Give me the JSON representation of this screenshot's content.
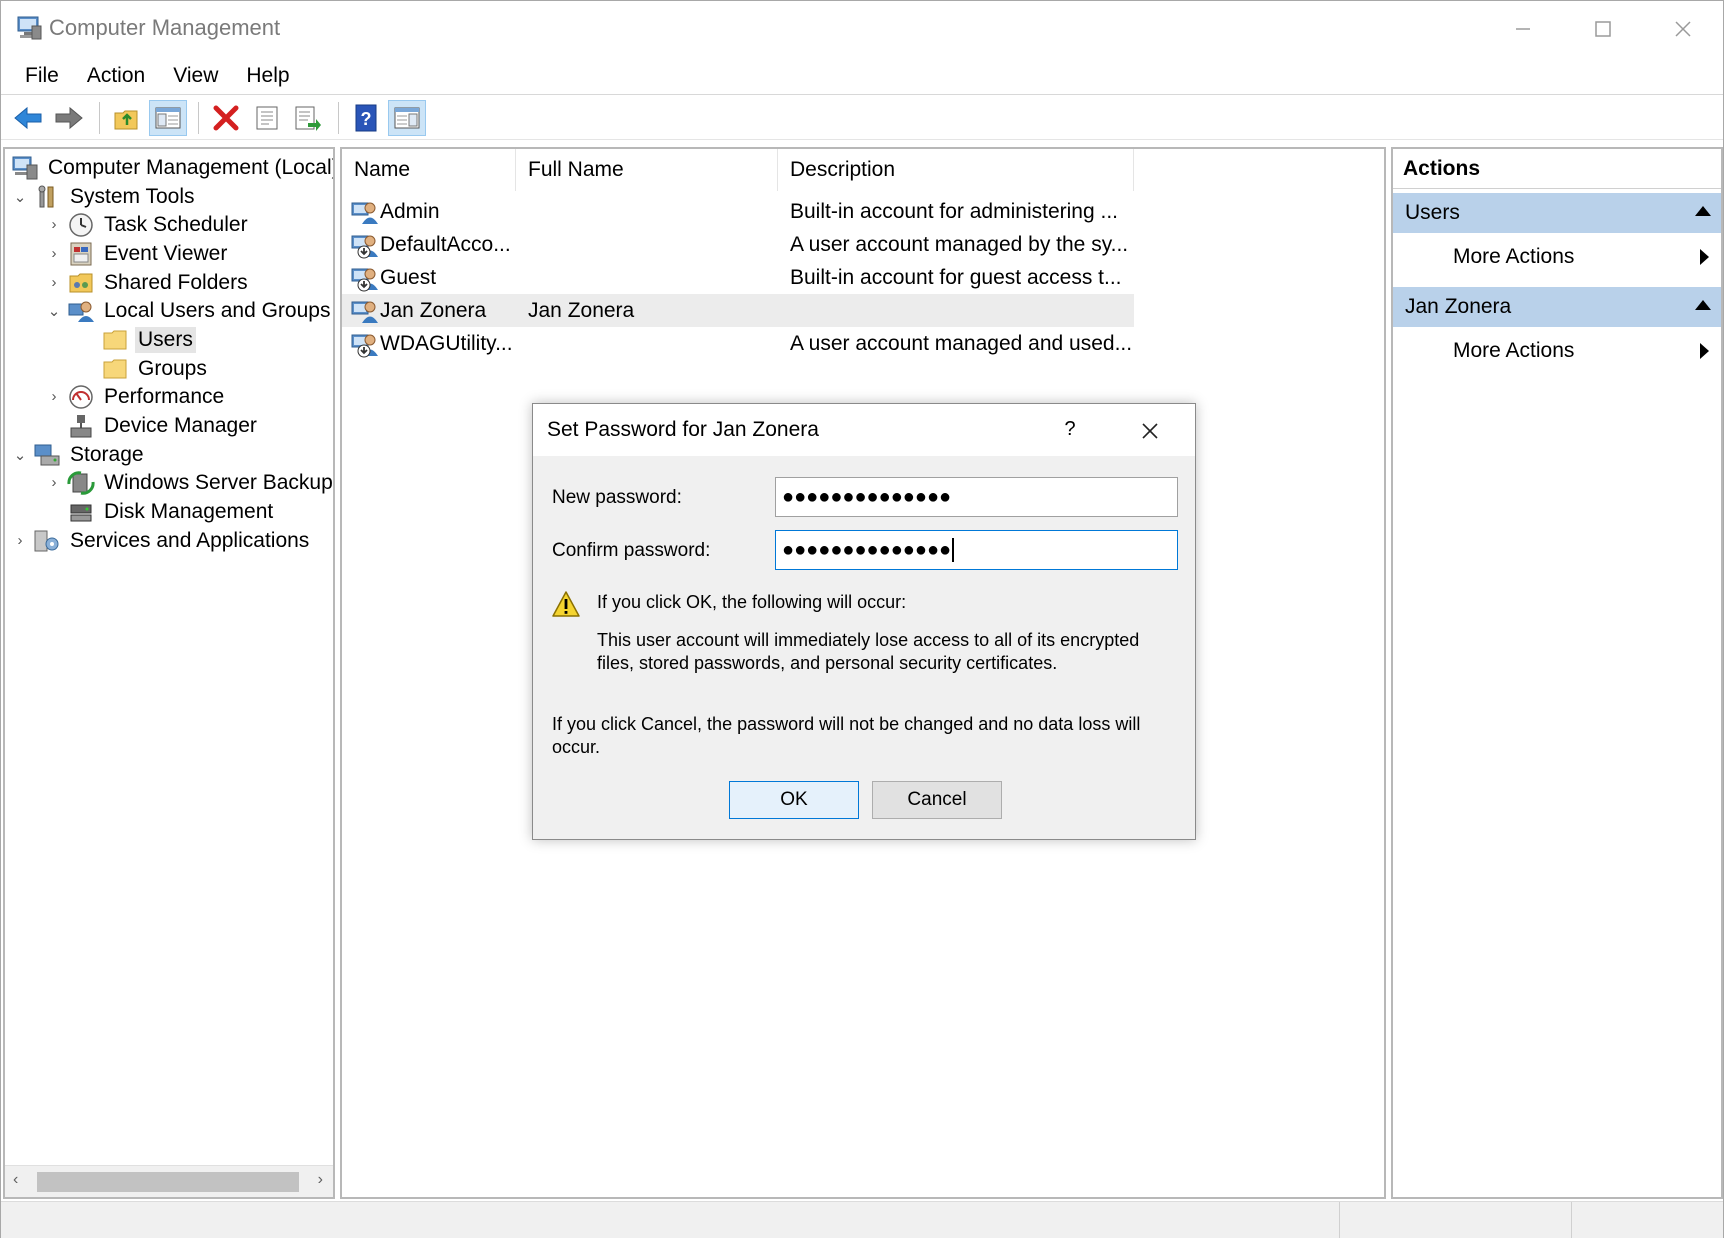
{
  "window": {
    "title": "Computer Management",
    "controls": {
      "minimize": "minimize-icon",
      "maximize": "maximize-icon",
      "close": "close-icon"
    }
  },
  "menu": [
    "File",
    "Action",
    "View",
    "Help"
  ],
  "toolbar": {
    "icons": [
      "back-icon",
      "forward-icon",
      "up-folder-icon",
      "show-hide-console-tree-icon",
      "delete-icon",
      "properties-icon",
      "export-list-icon",
      "help-icon",
      "show-hide-action-pane-icon"
    ]
  },
  "tree": {
    "items": [
      {
        "label": "Computer Management (Local)",
        "icon": "computer-management-icon",
        "expander": ""
      },
      {
        "label": "System Tools",
        "icon": "system-tools-icon",
        "expander": "expanded"
      },
      {
        "label": "Task Scheduler",
        "icon": "task-scheduler-icon",
        "expander": "collapsed"
      },
      {
        "label": "Event Viewer",
        "icon": "event-viewer-icon",
        "expander": "collapsed"
      },
      {
        "label": "Shared Folders",
        "icon": "shared-folders-icon",
        "expander": "collapsed"
      },
      {
        "label": "Local Users and Groups",
        "icon": "local-users-groups-icon",
        "expander": "expanded"
      },
      {
        "label": "Users",
        "icon": "folder-icon",
        "expander": "",
        "selected": true
      },
      {
        "label": "Groups",
        "icon": "folder-icon",
        "expander": ""
      },
      {
        "label": "Performance",
        "icon": "performance-icon",
        "expander": "collapsed"
      },
      {
        "label": "Device Manager",
        "icon": "device-manager-icon",
        "expander": ""
      },
      {
        "label": "Storage",
        "icon": "storage-icon",
        "expander": "expanded"
      },
      {
        "label": "Windows Server Backup",
        "icon": "windows-server-backup-icon",
        "expander": "collapsed"
      },
      {
        "label": "Disk Management",
        "icon": "disk-management-icon",
        "expander": ""
      },
      {
        "label": "Services and Applications",
        "icon": "services-applications-icon",
        "expander": "collapsed"
      }
    ]
  },
  "list": {
    "columns": [
      "Name",
      "Full Name",
      "Description"
    ],
    "rows": [
      {
        "name": "Admin",
        "full_name": "",
        "description": "Built-in account for administering ...",
        "icon": "user-icon"
      },
      {
        "name": "DefaultAcco...",
        "full_name": "",
        "description": "A user account managed by the sy...",
        "icon": "disabled-user-icon"
      },
      {
        "name": "Guest",
        "full_name": "",
        "description": "Built-in account for guest access t...",
        "icon": "disabled-user-icon"
      },
      {
        "name": "Jan Zonera",
        "full_name": "Jan Zonera",
        "description": "",
        "icon": "user-icon",
        "selected": true
      },
      {
        "name": "WDAGUtility...",
        "full_name": "",
        "description": "A user account managed and used...",
        "icon": "disabled-user-icon"
      }
    ]
  },
  "actions": {
    "title": "Actions",
    "sections": [
      {
        "header": "Users",
        "items": [
          "More Actions"
        ]
      },
      {
        "header": "Jan Zonera",
        "items": [
          "More Actions"
        ]
      }
    ]
  },
  "dialog": {
    "title": "Set Password for Jan Zonera",
    "help_label": "?",
    "new_password_label": "New password:",
    "new_password_value": "●●●●●●●●●●●●●●",
    "confirm_password_label": "Confirm password:",
    "confirm_password_value": "●●●●●●●●●●●●●●",
    "warning_heading": "If you click OK, the following will occur:",
    "warning_body": "This user account will immediately lose access to all of its encrypted files, stored passwords, and personal security certificates.",
    "cancel_note": "If you click Cancel, the password will not be changed and no data loss will occur.",
    "ok_label": "OK",
    "cancel_label": "Cancel"
  },
  "colors": {
    "section_header_bg": "#b9d1ea",
    "focus_border": "#0078d7",
    "selection_bg": "#e5e5e5",
    "dialog_bg": "#f0f0f0"
  }
}
